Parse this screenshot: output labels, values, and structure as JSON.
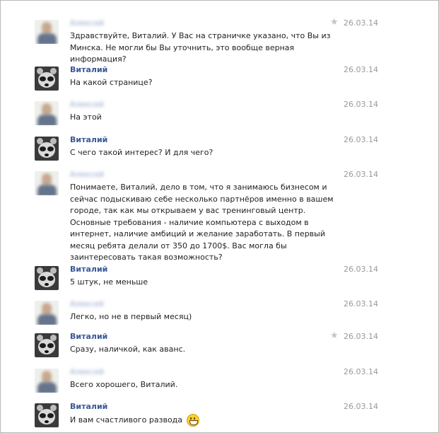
{
  "messages": [
    {
      "sender": "Алексей",
      "avatar": "blurred-person",
      "date": "26.03.14",
      "starred": true,
      "text": "Здравствуйте, Виталий. У Вас на страничке указано, что Вы из Минска. Не могли бы Вы уточнить, это вообще верная информация?"
    },
    {
      "sender": "Виталий",
      "avatar": "raccoon",
      "date": "26.03.14",
      "starred": false,
      "text": "На какой странице?"
    },
    {
      "sender": "Алексей",
      "avatar": "blurred-person",
      "date": "26.03.14",
      "starred": false,
      "text": "На этой"
    },
    {
      "sender": "Виталий",
      "avatar": "raccoon",
      "date": "26.03.14",
      "starred": false,
      "text": "С чего такой интерес? И для чего?"
    },
    {
      "sender": "Алексей",
      "avatar": "blurred-person",
      "date": "26.03.14",
      "starred": false,
      "text": "Понимаете, Виталий, дело в том, что я занимаюсь бизнесом и сейчас подыскиваю себе несколько партнёров именно в вашем городе, так как мы открываем у вас тренинговый центр. Основные требования - наличие компьютера с выходом в интернет, наличие амбиций и желание заработать. В первый месяц ребята делали от 350 до 1700$. Вас могла бы заинтересовать такая возможность?"
    },
    {
      "sender": "Виталий",
      "avatar": "raccoon",
      "date": "26.03.14",
      "starred": false,
      "text": "5 штук, не меньше"
    },
    {
      "sender": "Алексей",
      "avatar": "blurred-person",
      "date": "26.03.14",
      "starred": false,
      "text": "Легко, но не в первый месяц)"
    },
    {
      "sender": "Виталий",
      "avatar": "raccoon",
      "date": "26.03.14",
      "starred": true,
      "text": "Сразу, наличкой, как аванс."
    },
    {
      "sender": "Алексей",
      "avatar": "blurred-person",
      "date": "26.03.14",
      "starred": false,
      "text": "Всего хорошего, Виталий."
    },
    {
      "sender": "Виталий",
      "avatar": "raccoon",
      "date": "26.03.14",
      "starred": false,
      "text": "И вам счастливого развода",
      "emoji": "grin-emoji"
    }
  ],
  "colors": {
    "name": "#3b5998",
    "text": "#222222",
    "date": "#999999",
    "star": "#c4c4c4"
  }
}
